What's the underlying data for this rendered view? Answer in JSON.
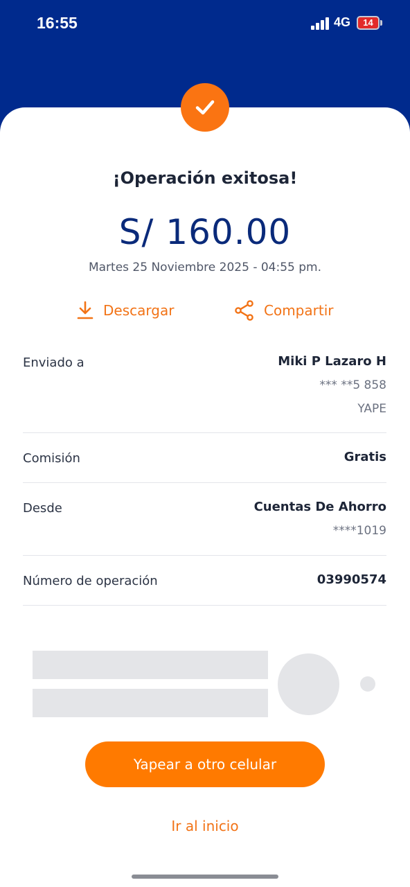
{
  "status_bar": {
    "time": "16:55",
    "network": "4G",
    "battery": "14",
    "battery_color": "#e22a2a"
  },
  "header": {
    "color": "#002a8d"
  },
  "receipt": {
    "success_icon": "check-icon",
    "title": "¡Operación exitosa!",
    "amount": "S/ 160.00",
    "datetime": "Martes 25 Noviembre 2025 - 04:55 pm.",
    "accent_color": "#f27316"
  },
  "actions": {
    "download_label": "Descargar",
    "download_icon": "download-icon",
    "share_label": "Compartir",
    "share_icon": "share-icon"
  },
  "details": {
    "sent_to_label": "Enviado a",
    "sent_to_name": "Miki P Lazaro H",
    "sent_to_phone": "*** **5 858",
    "sent_to_app": "YAPE",
    "commission_label": "Comisión",
    "commission_value": "Gratis",
    "from_label": "Desde",
    "from_account": "Cuentas De Ahorro",
    "from_number": "****1019",
    "operation_label": "Número de operación",
    "operation_number": "03990574"
  },
  "buttons": {
    "primary_label": "Yapear a otro celular",
    "primary_color": "#ff7a00",
    "home_label": "Ir al inicio"
  }
}
